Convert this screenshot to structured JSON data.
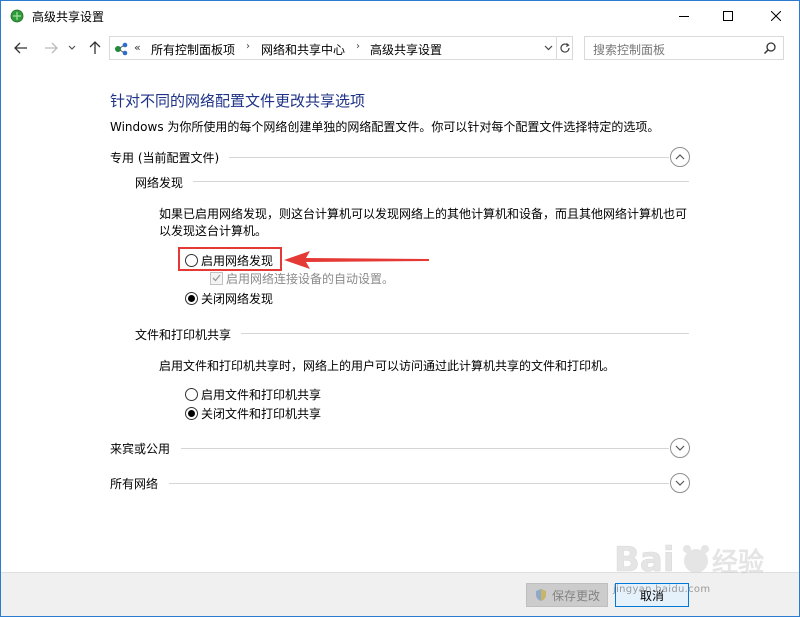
{
  "window": {
    "title": "高级共享设置"
  },
  "nav": {
    "address_overflow": "«",
    "breadcrumbs": [
      {
        "label": "所有控制面板项"
      },
      {
        "label": "网络和共享中心"
      },
      {
        "label": "高级共享设置"
      }
    ],
    "search_placeholder": "搜索控制面板"
  },
  "page": {
    "title": "针对不同的网络配置文件更改共享选项",
    "description": "Windows 为你所使用的每个网络创建单独的网络配置文件。你可以针对每个配置文件选择特定的选项。"
  },
  "profiles": {
    "private": {
      "header": "专用 (当前配置文件)",
      "expanded": true,
      "network_discovery": {
        "header": "网络发现",
        "description": "如果已启用网络发现，则这台计算机可以发现网络上的其他计算机和设备，而且其他网络计算机也可以发现这台计算机。",
        "options": [
          {
            "label": "启用网络发现",
            "checked": false
          },
          {
            "label": "关闭网络发现",
            "checked": true
          }
        ],
        "auto_setup_label": "启用网络连接设备的自动设置。",
        "auto_setup_checked": true,
        "auto_setup_enabled": false
      },
      "file_printer_sharing": {
        "header": "文件和打印机共享",
        "description": "启用文件和打印机共享时，网络上的用户可以访问通过此计算机共享的文件和打印机。",
        "options": [
          {
            "label": "启用文件和打印机共享",
            "checked": false
          },
          {
            "label": "关闭文件和打印机共享",
            "checked": true
          }
        ]
      }
    },
    "guest_public": {
      "header": "来宾或公用",
      "expanded": false
    },
    "all_networks": {
      "header": "所有网络",
      "expanded": false
    }
  },
  "footer": {
    "save_label": "保存更改",
    "save_enabled": false,
    "cancel_label": "取消"
  },
  "watermark": {
    "text": "jingyan.baidu.com"
  },
  "colors": {
    "title_blue": "#1e3287",
    "highlight_red": "#e53935",
    "window_border": "#2b7bd1"
  }
}
